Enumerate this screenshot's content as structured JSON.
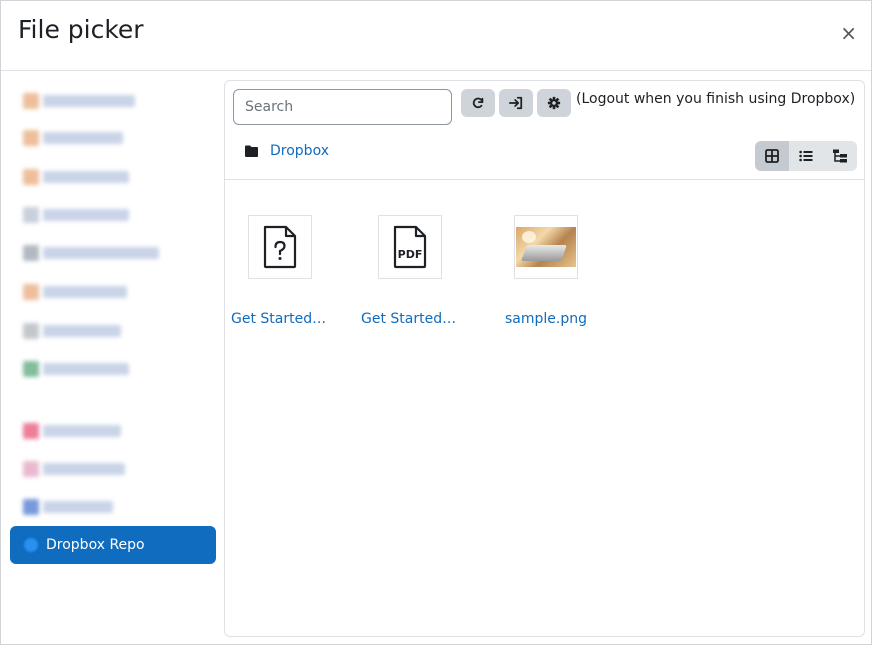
{
  "dialog": {
    "title": "File picker",
    "close_symbol": "×"
  },
  "sidebar": {
    "repos_blurred": [
      {
        "icon_color": "#e8a97a",
        "label_color": "#c9d4e8"
      },
      {
        "icon_color": "#e8a97a",
        "label_color": "#c9d4e8"
      },
      {
        "icon_color": "#e8a97a",
        "label_color": "#c9d4e8"
      },
      {
        "icon_color": "#b8c0d0",
        "label_color": "#c9d4e8"
      },
      {
        "icon_color": "#9aa2ad",
        "label_color": "#c9d4e8"
      },
      {
        "icon_color": "#e8a97a",
        "label_color": "#c9d4e8"
      },
      {
        "icon_color": "#b0b5bc",
        "label_color": "#c9d4e8"
      },
      {
        "icon_color": "#5aa77b",
        "label_color": "#c9d4e8"
      },
      {
        "icon_color": "#e8527a",
        "label_color": "#c9d4e8"
      },
      {
        "icon_color": "#e3a2c0",
        "label_color": "#c9d4e8"
      },
      {
        "icon_color": "#4a78d0",
        "label_color": "#c9d4e8"
      }
    ],
    "active_repo": {
      "label": "Dropbox Repo",
      "color": "#0f6cbf"
    }
  },
  "toolbar": {
    "search_placeholder": "Search",
    "refresh_icon": "refresh-icon",
    "login_icon": "sign-in-icon",
    "settings_icon": "gear-icon",
    "logout_note": "(Logout when you finish using Dropbox)"
  },
  "breadcrumb": {
    "folder_icon": "folder-icon",
    "label": "Dropbox"
  },
  "view_modes": [
    {
      "name": "icons",
      "icon": "grid-icon",
      "active": true
    },
    {
      "name": "list",
      "icon": "list-icon",
      "active": false
    },
    {
      "name": "tree",
      "icon": "tree-icon",
      "active": false
    }
  ],
  "files": [
    {
      "name": "Get Started …",
      "type": "unknown",
      "icon": "file-question-icon"
    },
    {
      "name": "Get Started …",
      "type": "pdf",
      "icon": "file-pdf-icon",
      "badge": "PDF"
    },
    {
      "name": "sample.png",
      "type": "image",
      "icon": "image-thumbnail"
    }
  ],
  "colors": {
    "link": "#0f6cbf",
    "button_bg": "#ced4da",
    "border": "#dee2e6"
  }
}
